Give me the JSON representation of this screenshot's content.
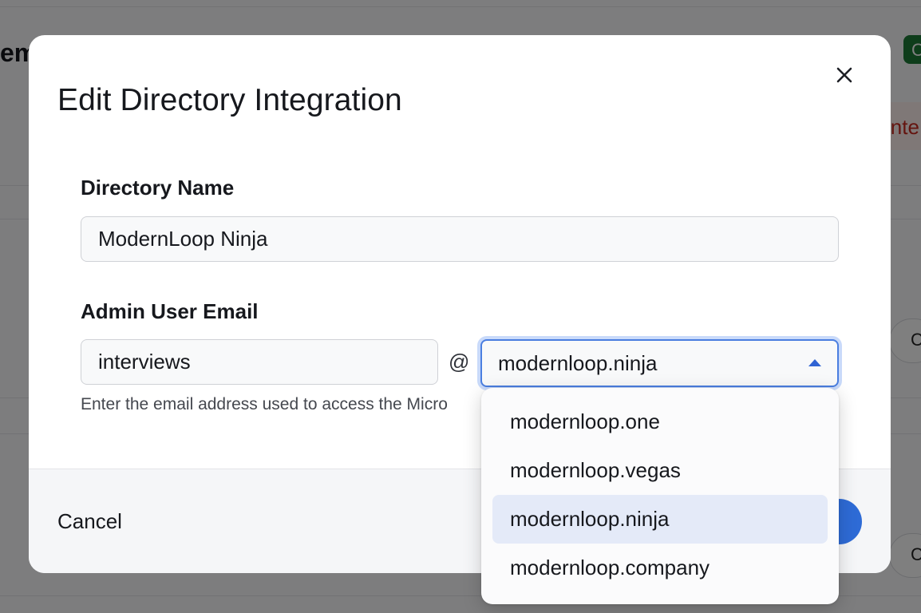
{
  "background": {
    "title_fragment": "em",
    "badge_text": "C",
    "pill_text": "inte",
    "button_fragment_1": "C",
    "button_fragment_2": "C"
  },
  "modal": {
    "title": "Edit Directory Integration",
    "close_icon": "close-icon",
    "directory_name": {
      "label": "Directory Name",
      "value": "ModernLoop Ninja"
    },
    "admin_email": {
      "label": "Admin User Email",
      "local_part": "interviews",
      "at_symbol": "@",
      "domain_selected": "modernloop.ninja",
      "helper_text": "Enter the email address used to access the Micro"
    },
    "footer": {
      "cancel_label": "Cancel"
    }
  },
  "dropdown": {
    "options": [
      "modernloop.one",
      "modernloop.vegas",
      "modernloop.ninja",
      "modernloop.company"
    ],
    "selected_index": 2
  },
  "colors": {
    "accent": "#2e6bd6",
    "focus_ring": "#c9dafa",
    "selected_option": "#e4eaf8",
    "overlay": "rgba(0,0,0,0.5)"
  }
}
